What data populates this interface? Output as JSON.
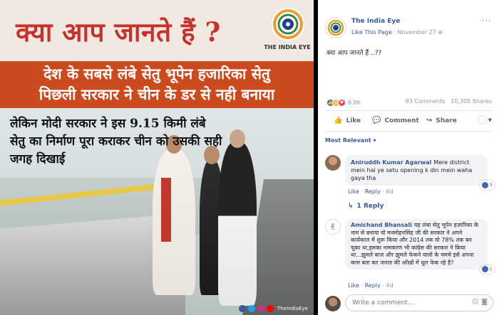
{
  "image_post": {
    "headline": "क्या आप जानते हैं ?",
    "brand_text": "THE INDIA EYE",
    "red_line_1": "देश के सबसे लंबे सेतु भूपेन हजारिका सेतु",
    "red_line_2": "पिछली सरकार ने चीन के डर से नही बनाया",
    "body_text": "लेकिन मोदी सरकार ने इस 9.15 किमी लंबे सेतु का निर्माण पूरा कराकर चीन को उसकी सही जगह दिखाई",
    "footer_handle": "TheIndiaEye"
  },
  "post": {
    "page_name": "The India Eye",
    "like_page": "Like This Page",
    "separator": "·",
    "date": "November 27",
    "globe_icon": "globe-icon",
    "text": "क्या आप जानते हैं ..??",
    "reaction_count": "8.8K",
    "comments_count": "93 Comments",
    "shares_count": "10,305 Shares"
  },
  "actions": {
    "like": "Like",
    "comment": "Comment",
    "share": "Share"
  },
  "comments_section": {
    "sort_label": "Most Relevant ▾",
    "view_replies": "1 Reply",
    "write_placeholder": "Write a comment..."
  },
  "comments": [
    {
      "author": "Aniruddh Kumar Agarwal",
      "text": "Mere district mein hai ye setu opening k din mein waha gaya tha",
      "like": "Like",
      "reply": "Reply",
      "age": "6d",
      "reactions": "9"
    },
    {
      "author": "Amichand Bhansali",
      "text": "यह लंबा सेतु भूपेन हज़ारिका के नाम से बनाया वो मनमोहनसिंह जी की सरकार ने अपने कार्यकाल में शुरू किया और 2014 तक वो 78% तक बन चूका था,इसका नामकरण भी कांग्रेस की सरकार ने किया था...झुमले बाज और झुमले फेकने वालो के चमचे इसे अपना काम बता कर जनता की आँखों में धूल फेक रहे है?",
      "like": "Like",
      "reply": "Reply",
      "age": "4d",
      "reactions": "5"
    }
  ],
  "colors": {
    "headline_red": "#c8302b",
    "band_orange": "#cc4b1e",
    "fb_link": "#365899",
    "fb_meta": "#90949c"
  }
}
